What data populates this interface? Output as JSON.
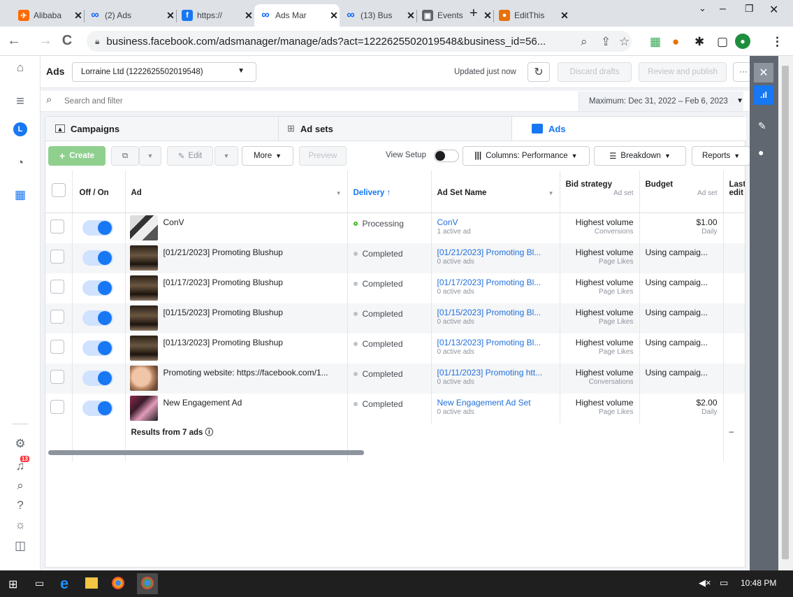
{
  "browser": {
    "tabs": [
      {
        "title": "Alibaba",
        "fav": "ali",
        "color": "#ff6a00"
      },
      {
        "title": "(2) Ads",
        "fav": "meta",
        "color": "#0866ff"
      },
      {
        "title": "https://",
        "fav": "fb",
        "color": "#1877f2"
      },
      {
        "title": "Ads Mar",
        "fav": "meta",
        "color": "#0866ff",
        "active": true
      },
      {
        "title": "(13) Bus",
        "fav": "meta",
        "color": "#0866ff"
      },
      {
        "title": "Events",
        "fav": "cal",
        "color": "#5f6368"
      },
      {
        "title": "EditThis",
        "fav": "cookie",
        "color": "#e8710a"
      }
    ],
    "url": "business.facebook.com/adsmanager/manage/ads?act=1222625502019548&business_id=56..."
  },
  "header": {
    "title": "Ads",
    "account": "Lorraine Ltd (1222625502019548)",
    "updated": "Updated just now",
    "discard": "Discard drafts",
    "review": "Review and publish",
    "more": "···"
  },
  "search": {
    "placeholder": "Search and filter",
    "daterange": "Maximum: Dec 31, 2022 – Feb 6, 2023"
  },
  "levels": {
    "campaigns": "Campaigns",
    "adsets": "Ad sets",
    "ads": "Ads"
  },
  "actions": {
    "create": "Create",
    "edit": "Edit",
    "more": "More",
    "preview": "Preview",
    "view_setup": "View Setup",
    "columns": "Columns: Performance",
    "breakdown": "Breakdown",
    "reports": "Reports"
  },
  "table": {
    "headers": {
      "offon": "Off / On",
      "ad": "Ad",
      "delivery": "Delivery ↑",
      "adset": "Ad Set Name",
      "bid": "Bid strategy",
      "bid_sub": "Ad set",
      "budget": "Budget",
      "budget_sub": "Ad set",
      "last": "Last",
      "last2": "edit"
    },
    "rows": [
      {
        "ad": "ConV",
        "thumb": "conv",
        "delivery": "Processing",
        "delivery_color": "#42b72a",
        "adset": "ConV",
        "adset_sub": "1 active ad",
        "bid": "Highest volume",
        "bid_sub": "Conversions",
        "budget": "$1.00",
        "budget_sub": "Daily"
      },
      {
        "ad": "[01/21/2023] Promoting Blushup",
        "thumb": "store",
        "delivery": "Completed",
        "delivery_color": "#bec3c9",
        "adset": "[01/21/2023] Promoting Bl...",
        "adset_sub": "0 active ads",
        "bid": "Highest volume",
        "bid_sub": "Page Likes",
        "budget": "Using campaig...",
        "budget_sub": ""
      },
      {
        "ad": "[01/17/2023] Promoting Blushup",
        "thumb": "store",
        "delivery": "Completed",
        "delivery_color": "#bec3c9",
        "adset": "[01/17/2023] Promoting Bl...",
        "adset_sub": "0 active ads",
        "bid": "Highest volume",
        "bid_sub": "Page Likes",
        "budget": "Using campaig...",
        "budget_sub": ""
      },
      {
        "ad": "[01/15/2023] Promoting Blushup",
        "thumb": "store",
        "delivery": "Completed",
        "delivery_color": "#bec3c9",
        "adset": "[01/15/2023] Promoting Bl...",
        "adset_sub": "0 active ads",
        "bid": "Highest volume",
        "bid_sub": "Page Likes",
        "budget": "Using campaig...",
        "budget_sub": ""
      },
      {
        "ad": "[01/13/2023] Promoting Blushup",
        "thumb": "store",
        "delivery": "Completed",
        "delivery_color": "#bec3c9",
        "adset": "[01/13/2023] Promoting Bl...",
        "adset_sub": "0 active ads",
        "bid": "Highest volume",
        "bid_sub": "Page Likes",
        "budget": "Using campaig...",
        "budget_sub": ""
      },
      {
        "ad": "Promoting website: https://facebook.com/1...",
        "thumb": "face",
        "delivery": "Completed",
        "delivery_color": "#bec3c9",
        "adset": "[01/11/2023] Promoting htt...",
        "adset_sub": "0 active ads",
        "bid": "Highest volume",
        "bid_sub": "Conversations",
        "budget": "Using campaig...",
        "budget_sub": ""
      },
      {
        "ad": "New Engagement Ad",
        "thumb": "makeup",
        "delivery": "Completed",
        "delivery_color": "#bec3c9",
        "adset": "New Engagement Ad Set",
        "adset_sub": "0 active ads",
        "bid": "Highest volume",
        "bid_sub": "Page Likes",
        "budget": "$2.00",
        "budget_sub": "Daily"
      }
    ],
    "results": "Results from 7 ads",
    "results_dash": "–"
  },
  "taskbar": {
    "time": "10:48 PM"
  },
  "notif_count": "13",
  "user_initial": "L"
}
